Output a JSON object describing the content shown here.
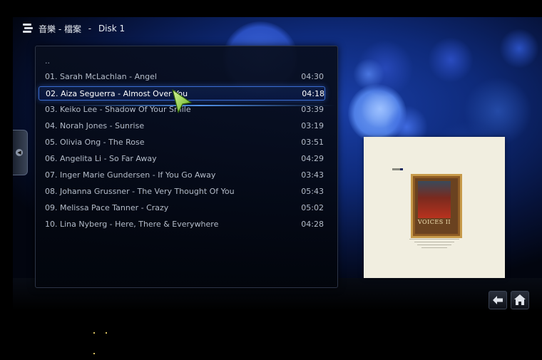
{
  "header": {
    "section": "音樂 - 檔案",
    "separator": " - ",
    "location": "Disk 1"
  },
  "list": {
    "parent_item": "..",
    "focused_index": 1,
    "items": [
      {
        "title": "01. Sarah McLachlan - Angel",
        "duration": "04:30"
      },
      {
        "title": "02. Aiza Seguerra - Almost Over You",
        "duration": "04:18"
      },
      {
        "title": "03. Keiko Lee - Shadow Of Your Smile",
        "duration": "03:39"
      },
      {
        "title": "04. Norah Jones - Sunrise",
        "duration": "03:19"
      },
      {
        "title": "05. Olivia Ong - The Rose",
        "duration": "03:51"
      },
      {
        "title": "06. Angelita Li - So Far Away",
        "duration": "04:29"
      },
      {
        "title": "07. Inger Marie Gundersen - If You Go Away",
        "duration": "03:43"
      },
      {
        "title": "08. Johanna Grussner - The Very Thought Of You",
        "duration": "05:43"
      },
      {
        "title": "09. Melissa Pace Tanner - Crazy",
        "duration": "05:02"
      },
      {
        "title": "10. Lina Nyberg - Here, There & Everywhere",
        "duration": "04:28"
      }
    ]
  },
  "album_art": {
    "caption": "VOICES II"
  },
  "icons": {
    "back": "back-arrow-icon",
    "home": "home-icon",
    "logo": "music-logo-icon",
    "cursor": "pointer-cursor-icon"
  },
  "colors": {
    "accent": "#3a6cd0",
    "text": "#b4bcc9",
    "focused_text": "#ffffff",
    "cursor": "#8fd13a"
  }
}
